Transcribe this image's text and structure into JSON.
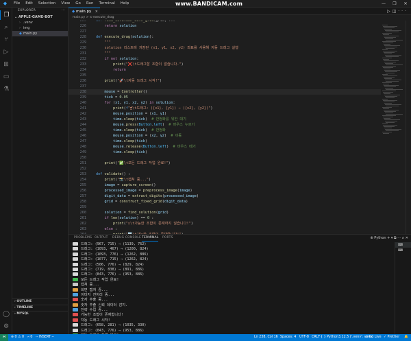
{
  "titlebar": {
    "menu": [
      "File",
      "Edit",
      "Selection",
      "View",
      "Go",
      "Run",
      "Terminal",
      "Help"
    ],
    "watermark": "www.BANDICAM.com",
    "window_controls": [
      "—",
      "❐",
      "✕"
    ]
  },
  "activity_icons": [
    "files-icon",
    "search-icon",
    "source-control-icon",
    "run-debug-icon",
    "extensions-icon",
    "remote-icon",
    "testing-icon"
  ],
  "sidebar": {
    "title": "EXPLORER",
    "title_more": "···",
    "folder": "APPLE-GAME-BOT",
    "items": [
      {
        "label": ".venv",
        "type": "folder"
      },
      {
        "label": "img",
        "type": "folder"
      },
      {
        "label": "main.py",
        "type": "python"
      }
    ],
    "bottom": [
      "OUTLINE",
      "TIMELINE",
      "MYSQL"
    ]
  },
  "editor": {
    "tab_label": "main.py",
    "tab_close": "×",
    "breadcrumb": "main.py > ⊙ execute_drag",
    "cursor_line": 238,
    "code_lines": [
      {
        "n": "225",
        "html": "<span class=\"kw\">def</span> <span class=\"fn\">find_solution_with_grid</span>(grid) ..."
      },
      {
        "n": "226",
        "html": "    <span class=\"ctl\">return</span> <span class=\"var\">solution</span>"
      },
      {
        "n": "227",
        "html": ""
      },
      {
        "n": "228",
        "html": "<span class=\"kw\">def</span> <span class=\"fn\">execute_drag</span>(<span class=\"var\">solution</span>):"
      },
      {
        "n": "229",
        "html": "    <span class=\"str\">\"\"\"</span>"
      },
      {
        "n": "230",
        "html": "<span class=\"str\">    solution 리스트에 저장된 (x1, y1, x2, y2) 좌표를 사용해 자동 드래그 실행</span>"
      },
      {
        "n": "231",
        "html": "<span class=\"str\">    \"\"\"</span>"
      },
      {
        "n": "232",
        "html": "    <span class=\"ctl\">if not</span> <span class=\"var\">solution</span>:"
      },
      {
        "n": "233",
        "html": "        <span class=\"fn\">print</span>(<span class=\"str\">\"❌\\t드래그할 조합이 없습니다.\"</span>)"
      },
      {
        "n": "234",
        "html": "        <span class=\"ctl\">return</span>"
      },
      {
        "n": "235",
        "html": ""
      },
      {
        "n": "236",
        "html": "    <span class=\"fn\">print</span>(<span class=\"str\">\"🚀\\t자동 드래그 시작!\"</span>)"
      },
      {
        "n": "237",
        "html": ""
      },
      {
        "n": "238",
        "html": "    <span class=\"var\">mouse</span> = <span class=\"fn\">Controller</span>()"
      },
      {
        "n": "239",
        "html": "    <span class=\"var\">tick</span> = <span class=\"num\">0.05</span>"
      },
      {
        "n": "240",
        "html": "    <span class=\"ctl\">for</span> (<span class=\"var\">x1</span>, <span class=\"var\">y1</span>, <span class=\"var\">x2</span>, <span class=\"var\">y2</span>) <span class=\"ctl\">in</span> <span class=\"var\">solution</span>:"
      },
      {
        "n": "241",
        "html": "        <span class=\"fn\">print</span>(<span class=\"kw\">f</span><span class=\"str\">\"🖱\\t드래그: ({x1}, {y1}) → ({x2}, {y2})\"</span>)"
      },
      {
        "n": "242",
        "html": "        <span class=\"var\">mouse</span>.<span class=\"var\">position</span> = (<span class=\"var\">x1</span>, <span class=\"var\">y1</span>)"
      },
      {
        "n": "243",
        "html": "        <span class=\"var\">time</span>.<span class=\"fn\">sleep</span>(<span class=\"var\">tick</span>)  <span class=\"cmt\"># 안정화를 위한 대기</span>"
      },
      {
        "n": "244",
        "html": "        <span class=\"var\">mouse</span>.<span class=\"fn\">press</span>(<span class=\"const\">Button</span>.<span class=\"const\">left</span>)  <span class=\"cmt\"># 마우스 누르기</span>"
      },
      {
        "n": "245",
        "html": "        <span class=\"var\">time</span>.<span class=\"fn\">sleep</span>(<span class=\"var\">tick</span>)  <span class=\"cmt\"># 안정화</span>"
      },
      {
        "n": "246",
        "html": "        <span class=\"var\">mouse</span>.<span class=\"var\">position</span> = (<span class=\"var\">x2</span>, <span class=\"var\">y2</span>)  <span class=\"cmt\"># 이동</span>"
      },
      {
        "n": "247",
        "html": "        <span class=\"var\">time</span>.<span class=\"fn\">sleep</span>(<span class=\"var\">tick</span>)"
      },
      {
        "n": "248",
        "html": "        <span class=\"var\">mouse</span>.<span class=\"fn\">release</span>(<span class=\"const\">Button</span>.<span class=\"const\">left</span>)  <span class=\"cmt\"># 마우스 떼기</span>"
      },
      {
        "n": "249",
        "html": "        <span class=\"var\">time</span>.<span class=\"fn\">sleep</span>(<span class=\"var\">tick</span>)"
      },
      {
        "n": "250",
        "html": ""
      },
      {
        "n": "251",
        "html": "    <span class=\"fn\">print</span>(<span class=\"str\">\"✅\\t모든 드래그 작업 완료!\"</span>)"
      },
      {
        "n": "252",
        "html": ""
      },
      {
        "n": "253",
        "html": "<span class=\"kw\">def</span> <span class=\"fn\">validate</span>() :"
      },
      {
        "n": "254",
        "html": "    <span class=\"fn\">print</span>(<span class=\"str\">\"📸\\t캡쳐 중...\"</span>)"
      },
      {
        "n": "255",
        "html": "    <span class=\"var\">image</span> = <span class=\"fn\">capture_screen</span>()"
      },
      {
        "n": "256",
        "html": "    <span class=\"var\">processed_image</span> = <span class=\"fn\">preprocess_image</span>(<span class=\"var\">image</span>)"
      },
      {
        "n": "257",
        "html": "    <span class=\"var\">digit_data</span> = <span class=\"fn\">extract_digits</span>(<span class=\"var\">processed_image</span>)"
      },
      {
        "n": "258",
        "html": "    <span class=\"var\">grid</span> = <span class=\"fn\">construct_fixed_grid</span>(<span class=\"var\">digit_data</span>)"
      },
      {
        "n": "259",
        "html": ""
      },
      {
        "n": "260",
        "html": "    <span class=\"var\">solution</span> = <span class=\"fn\">find_solution</span>(<span class=\"var\">grid</span>)"
      },
      {
        "n": "261",
        "html": "    <span class=\"ctl\">if</span> <span class=\"fn\">len</span>(<span class=\"var\">solution</span>) == <span class=\"num\">0</span> :"
      },
      {
        "n": "262",
        "html": "        <span class=\"fn\">print</span>(<span class=\"str\">\"☑\\t가능한 조합이 존재하지 않습니다!\"</span>)"
      },
      {
        "n": "263",
        "html": "    <span class=\"ctl\">else</span> :"
      },
      {
        "n": "264",
        "html": "        <span class=\"fn\">print</span>(<span class=\"str\">\"🆗\\t가능한 조합이 존재합니다!\"</span>)"
      },
      {
        "n": "265",
        "html": "        <span class=\"fn\">execute_drag</span>(<span class=\"var\">solution</span>)"
      }
    ]
  },
  "panel": {
    "tabs": [
      "PROBLEMS",
      "OUTPUT",
      "DEBUG CONSOLE",
      "TERMINAL",
      "PORTS"
    ],
    "active_tab": "TERMINAL",
    "actions": "⊕ Python  +  ▾  ⧉  ···  ∧  ✕",
    "terminal_list": [
      "⌨",
      "⌨"
    ],
    "terminal_lines": [
      {
        "icon": "#d9d9d9",
        "text": "드래그: (967, 715) → (1139, 762)"
      },
      {
        "icon": "#d9d9d9",
        "text": "드래그: (1093, 467) → (1200, 824)"
      },
      {
        "icon": "#d9d9d9",
        "text": "드래그: (1093, 776) → (1262, 886)"
      },
      {
        "icon": "#d9d9d9",
        "text": "드래그: (1077, 715) → (1262, 824)"
      },
      {
        "icon": "#d9d9d9",
        "text": "드래그: (506, 776) → (829, 824)"
      },
      {
        "icon": "#d9d9d9",
        "text": "드래그: (719, 838) → (891, 886)"
      },
      {
        "icon": "#d9d9d9",
        "text": "드래그: (843, 776) → (953, 886)"
      },
      {
        "icon": "#3fb950",
        "text": "모든 드래그 작업 완료!"
      },
      {
        "icon": "#c8c8c8",
        "text": "캡쳐 중..."
      },
      {
        "icon": "#e0a040",
        "text": "회면 캡처 중..."
      },
      {
        "icon": "#4fa3e0",
        "text": "이미지 전처리 중..."
      },
      {
        "icon": "#e05050",
        "text": "숫자 추출 중..."
      },
      {
        "icon": "#e0a040",
        "text": "숫자 추출 신뢰 데이터 감지."
      },
      {
        "icon": "#4fa3e0",
        "text": "전략 수립 중..."
      },
      {
        "icon": "#e05050",
        "text": "가능한 조합이 존재합니다!"
      },
      {
        "icon": "#e05050",
        "text": "자동 드래그 시작!"
      },
      {
        "icon": "#d9d9d9",
        "text": "드래그: (658, 281) → (1035, 330)"
      },
      {
        "icon": "#d9d9d9",
        "text": "드래그: (843, 776) → (953, 886)"
      },
      {
        "icon": "#3fb950",
        "text": "모든 드래그 작업 완료!"
      },
      {
        "icon": "none",
        "text": "PS C:\\Users\\ahdo\\workspace\\apple-game-bot> █"
      }
    ]
  },
  "statusbar": {
    "remote": "⋈",
    "errors": "⊗ 0  ⚠ 0",
    "ports": "⑁ 0",
    "mode": "-- INSERT --",
    "position": "Ln 238, Col 16",
    "spaces": "Spaces: 4",
    "encoding": "UTF-8",
    "eol": "CRLF",
    "language": "{ } Python",
    "interpreter": "3.12.5 ('.venv': venv)",
    "golive": "⊙ Go Live",
    "prettier": "✓ Prettier",
    "bell": "🔔"
  }
}
